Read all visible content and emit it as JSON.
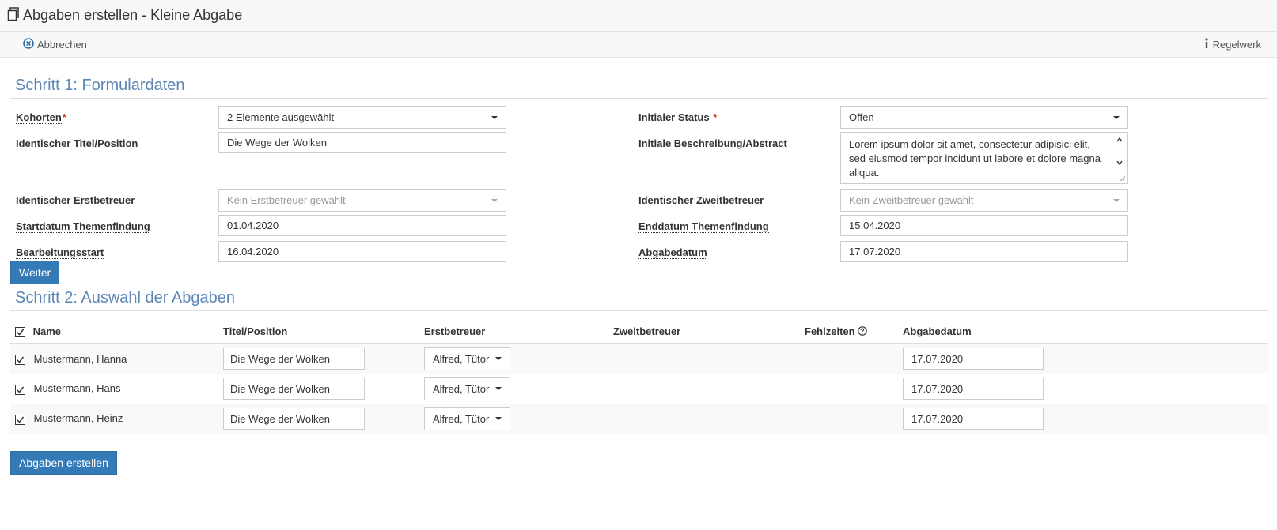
{
  "window": {
    "title": "Abgaben erstellen - Kleine Abgabe"
  },
  "toolbar": {
    "cancel_label": "Abbrechen",
    "rules_label": "Regelwerk"
  },
  "step1": {
    "title": "Schritt 1: Formulardaten",
    "kohorten": {
      "label": "Kohorten",
      "required": "*",
      "value": "2 Elemente ausgewählt"
    },
    "status": {
      "label": "Initialer Status",
      "required": "*",
      "value": "Offen"
    },
    "titel": {
      "label": "Identischer Titel/Position",
      "value": "Die Wege der Wolken"
    },
    "beschreibung": {
      "label": "Initiale Beschreibung/Abstract",
      "value": "Lorem ipsum dolor sit amet, consectetur adipisici elit, sed eiusmod tempor incidunt ut labore et dolore magna aliqua."
    },
    "erstbetreuer": {
      "label": "Identischer Erstbetreuer",
      "value": "Kein Erstbetreuer gewählt"
    },
    "zweitbetreuer": {
      "label": "Identischer Zweitbetreuer",
      "value": "Kein Zweitbetreuer gewählt"
    },
    "startdatum": {
      "label": "Startdatum Themenfindung",
      "value": "01.04.2020"
    },
    "enddatum": {
      "label": "Enddatum Themenfindung",
      "value": "15.04.2020"
    },
    "bearbeitungsstart": {
      "label": "Bearbeitungsstart",
      "value": "16.04.2020"
    },
    "abgabedatum": {
      "label": "Abgabedatum",
      "value": "17.07.2020"
    },
    "next_label": "Weiter"
  },
  "step2": {
    "title": "Schritt 2: Auswahl der Abgaben",
    "columns": {
      "name": "Name",
      "titel": "Titel/Position",
      "erstbetreuer": "Erstbetreuer",
      "zweitbetreuer": "Zweitbetreuer",
      "fehlzeiten": "Fehlzeiten",
      "abgabedatum": "Abgabedatum"
    },
    "rows": [
      {
        "name": "Mustermann, Hanna",
        "titel": "Die Wege der Wolken",
        "erstbetreuer": "Alfred, Tütor",
        "abgabedatum": "17.07.2020"
      },
      {
        "name": "Mustermann, Hans",
        "titel": "Die Wege der Wolken",
        "erstbetreuer": "Alfred, Tütor",
        "abgabedatum": "17.07.2020"
      },
      {
        "name": "Mustermann, Heinz",
        "titel": "Die Wege der Wolken",
        "erstbetreuer": "Alfred, Tütor",
        "abgabedatum": "17.07.2020"
      }
    ],
    "create_label": "Abgaben erstellen"
  },
  "icons": {
    "title": "copy-icon",
    "cancel": "close-circle-icon",
    "rules": "info-icon",
    "help": "help-circle-icon"
  },
  "colors": {
    "accent": "#5b86b5",
    "primary_button": "#337ab7",
    "required": "#c0392b"
  }
}
